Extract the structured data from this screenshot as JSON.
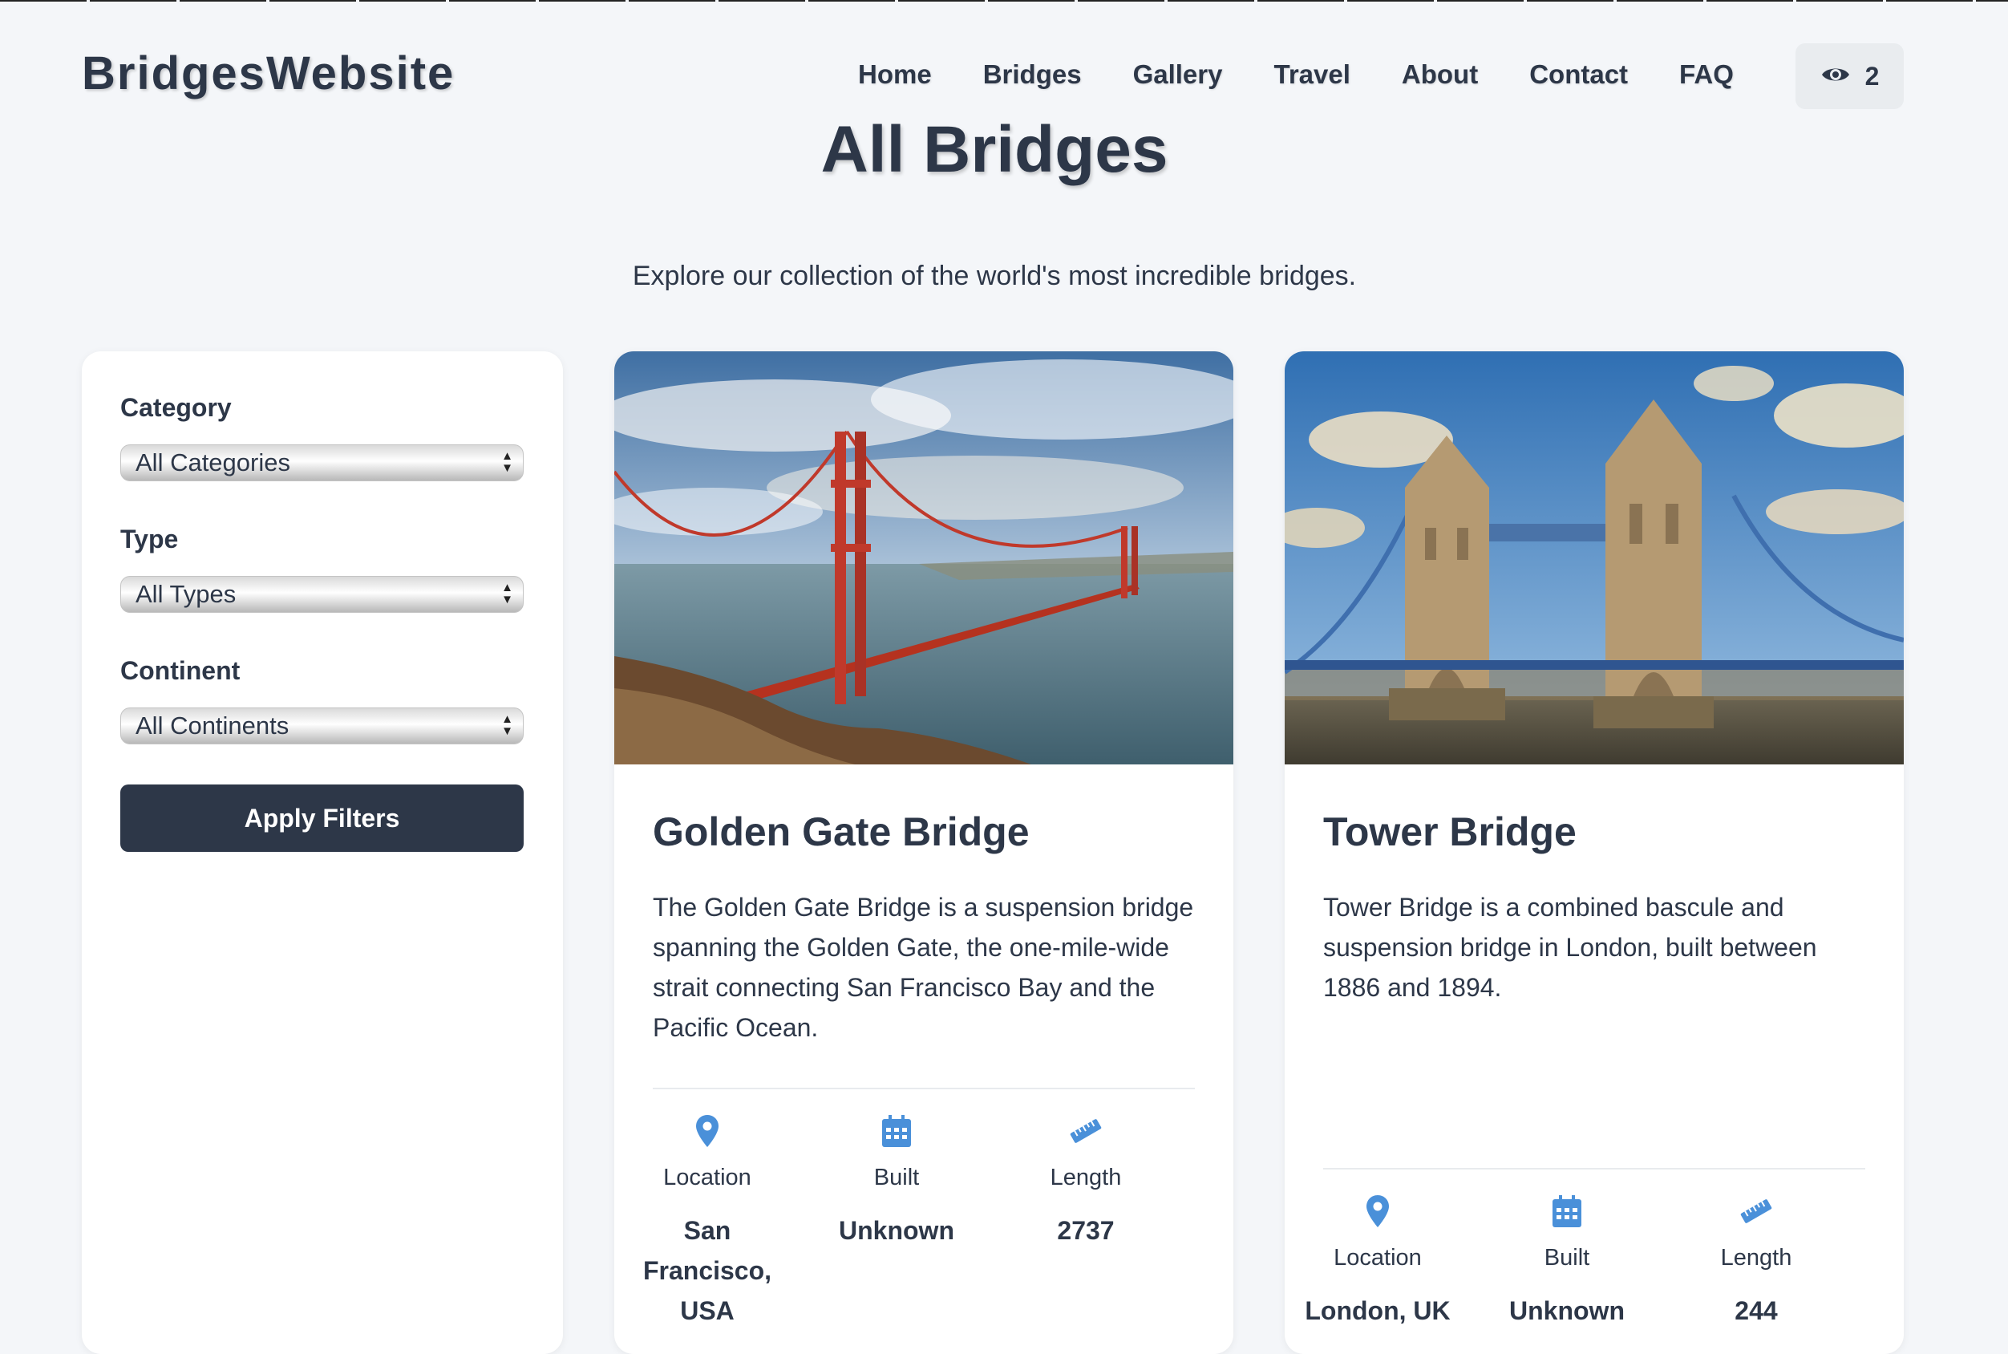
{
  "site": {
    "logo": "BridgesWebsite"
  },
  "nav": {
    "items": [
      "Home",
      "Bridges",
      "Gallery",
      "Travel",
      "About",
      "Contact",
      "FAQ"
    ]
  },
  "views": {
    "icon": "eye-icon",
    "count": "2"
  },
  "page": {
    "title": "All Bridges",
    "subtitle": "Explore our collection of the world's most incredible bridges."
  },
  "filters": {
    "category_label": "Category",
    "category_value": "All Categories",
    "type_label": "Type",
    "type_value": "All Types",
    "continent_label": "Continent",
    "continent_value": "All Continents",
    "apply_label": "Apply Filters"
  },
  "bridges": [
    {
      "name": "Golden Gate Bridge",
      "description": "The Golden Gate Bridge is a suspension bridge spanning the Golden Gate, the one-mile-wide strait connecting San Francisco Bay and the Pacific Ocean.",
      "location_label": "Location",
      "location": "San Francisco, USA",
      "built_label": "Built",
      "built": "Unknown",
      "length_label": "Length",
      "length": "2737"
    },
    {
      "name": "Tower Bridge",
      "description": "Tower Bridge is a combined bascule and suspension bridge in London, built between 1886 and 1894.",
      "location_label": "Location",
      "location": "London, UK",
      "built_label": "Built",
      "built": "Unknown",
      "length_label": "Length",
      "length": "244"
    }
  ],
  "colors": {
    "primary": "#2d3748",
    "accent": "#4a90d9",
    "background": "#f4f6f9"
  }
}
